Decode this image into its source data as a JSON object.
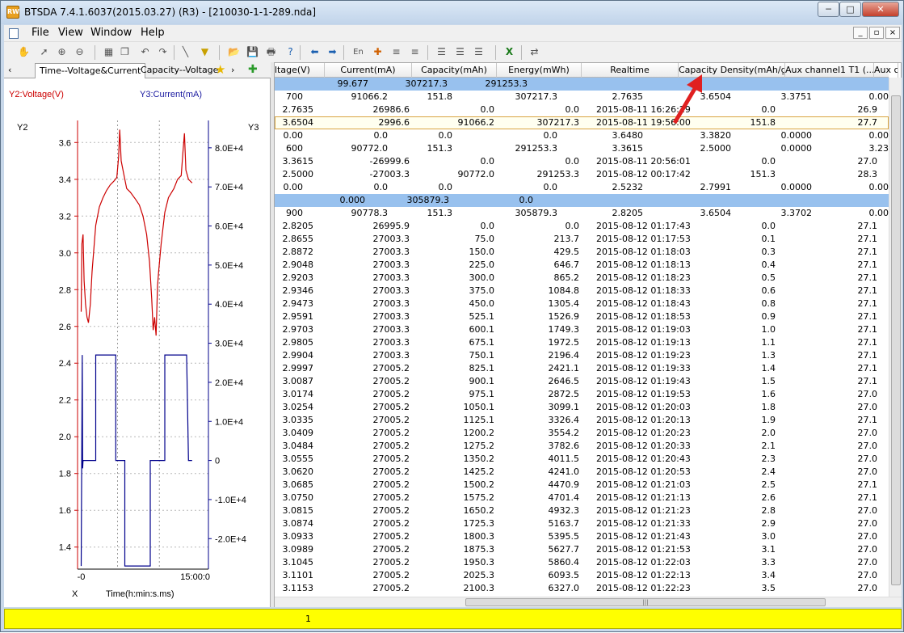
{
  "app": {
    "title": "BTSDA 7.4.1.6037(2015.03.27) (R3) - [210030-1-1-289.nda]",
    "icon_text": "RW"
  },
  "window_controls": {
    "minimize": "─",
    "maximize": "□",
    "close": "✕"
  },
  "menu": {
    "items": [
      "File",
      "View",
      "Window",
      "Help"
    ],
    "mdi": [
      "_",
      "▫",
      "×"
    ]
  },
  "toolbar": {
    "icons": [
      "hand-icon",
      "pointer-icon",
      "zoom-in-icon",
      "zoom-out-icon",
      "table-icon",
      "copy-icon",
      "undo-icon",
      "redo-icon",
      "line-tool-icon",
      "filter-icon",
      "open-icon",
      "save-icon",
      "print-icon",
      "help-icon",
      "back-icon",
      "forward-icon",
      "lang-icon",
      "marker-icon",
      "align-icon",
      "align2-icon",
      "list-icon",
      "list2-icon",
      "list3-icon",
      "excel-icon",
      "convert-icon"
    ],
    "lang_label": "En"
  },
  "tabs": {
    "items": [
      "Time--Voltage&Current",
      "Capacity--Voltage"
    ],
    "left_arrow": "‹",
    "right_arrow": "›"
  },
  "chart_data": {
    "type": "line",
    "xlabel": "Time(h:min:s.ms)",
    "x_axis_letter": "X",
    "x_tick_labels": [
      "-0",
      "15:00:0"
    ],
    "y2_title": "Y2:Voltage(V)",
    "y3_title": "Y3:Current(mA)",
    "y2_axis_letter": "Y2",
    "y3_axis_letter": "Y3",
    "y2_ticks": [
      1.4,
      1.6,
      1.8,
      2.0,
      2.2,
      2.4,
      2.6,
      2.8,
      3.0,
      3.2,
      3.4,
      3.6
    ],
    "y2_tick_labels": [
      "1.4",
      "1.6",
      "1.8",
      "2.0",
      "2.2",
      "2.4",
      "2.6",
      "2.8",
      "3.0",
      "3.2",
      "3.4",
      "3.6"
    ],
    "y2_range": [
      1.28,
      3.72
    ],
    "y3_ticks": [
      -20000,
      -10000,
      0,
      10000,
      20000,
      30000,
      40000,
      50000,
      60000,
      70000,
      80000
    ],
    "y3_tick_labels": [
      "-2.0E+4",
      "-1.0E+4",
      "0",
      "1.0E+4",
      "2.0E+4",
      "3.0E+4",
      "4.0E+4",
      "5.0E+4",
      "6.0E+4",
      "7.0E+4",
      "8.0E+4"
    ],
    "y3_range": [
      -27800,
      87000
    ],
    "x_range": [
      -1,
      35
    ],
    "x_grid": [
      10,
      21.5
    ],
    "series": [
      {
        "color": "#cc0000",
        "points": [
          [
            0,
            2.68
          ],
          [
            0.2,
            3.05
          ],
          [
            0.5,
            3.1
          ],
          [
            0.8,
            2.85
          ],
          [
            1.2,
            2.72
          ],
          [
            1.6,
            2.65
          ],
          [
            2,
            2.62
          ],
          [
            2.5,
            2.72
          ],
          [
            3,
            2.9
          ],
          [
            4,
            3.15
          ],
          [
            5,
            3.25
          ],
          [
            6,
            3.3
          ],
          [
            7,
            3.34
          ],
          [
            8,
            3.37
          ],
          [
            9,
            3.39
          ],
          [
            9.8,
            3.41
          ],
          [
            10.3,
            3.52
          ],
          [
            10.6,
            3.67
          ],
          [
            11,
            3.5
          ],
          [
            11.8,
            3.42
          ],
          [
            12.5,
            3.35
          ],
          [
            13.5,
            3.33
          ],
          [
            15,
            3.29
          ],
          [
            16,
            3.26
          ],
          [
            17,
            3.2
          ],
          [
            18,
            3.1
          ],
          [
            18.8,
            2.95
          ],
          [
            19.4,
            2.75
          ],
          [
            19.8,
            2.58
          ],
          [
            20.2,
            2.65
          ],
          [
            20.6,
            2.55
          ],
          [
            21,
            2.82
          ],
          [
            21.3,
            2.9
          ],
          [
            22,
            3.05
          ],
          [
            23,
            3.22
          ],
          [
            24,
            3.3
          ],
          [
            25.5,
            3.35
          ],
          [
            26.5,
            3.4
          ],
          [
            27.5,
            3.42
          ],
          [
            28,
            3.55
          ],
          [
            28.4,
            3.65
          ],
          [
            28.8,
            3.45
          ],
          [
            29.5,
            3.4
          ],
          [
            30.5,
            3.38
          ]
        ]
      },
      {
        "color": "#00008b",
        "axis": "y3",
        "points": [
          [
            0,
            -27000
          ],
          [
            0.3,
            27000
          ],
          [
            0.4,
            -2000
          ],
          [
            0.5,
            0
          ],
          [
            4,
            0
          ],
          [
            4,
            27000
          ],
          [
            9.5,
            27000
          ],
          [
            9.5,
            0
          ],
          [
            12,
            0
          ],
          [
            12,
            -27000
          ],
          [
            19,
            -27000
          ],
          [
            19,
            0
          ],
          [
            23,
            0
          ],
          [
            23,
            27000
          ],
          [
            29,
            27000
          ],
          [
            29.3,
            12000
          ],
          [
            29.5,
            0
          ],
          [
            30.5,
            0
          ]
        ]
      }
    ]
  },
  "table": {
    "columns": [
      "ltage(V)",
      "Current(mA)",
      "Capacity(mAh)",
      "Energy(mWh)",
      "Realtime",
      "Capacity Density(mAh/g)",
      "Aux channel1 T1 (...",
      "Aux c"
    ],
    "rows": [
      {
        "style": "blue",
        "cells": [
          "",
          "99.677",
          "307217.3",
          "291253.3",
          "",
          "",
          "",
          ""
        ],
        "shift": "summary"
      },
      {
        "style": "",
        "cells": [
          "700",
          "91066.2",
          "151.8",
          "307217.3",
          "2.7635",
          "3.6504",
          "3.3751",
          "0.00"
        ],
        "shift": "cycle"
      },
      {
        "style": "",
        "cells": [
          "2.7635",
          "26986.6",
          "0.0",
          "0.0",
          "2015-08-11 16:26:29",
          "",
          "0.0",
          "26.9"
        ],
        "shift": "step"
      },
      {
        "style": "sel",
        "cells": [
          "3.6504",
          "2996.6",
          "91066.2",
          "307217.3",
          "2015-08-11 19:56:00",
          "",
          "151.8",
          "27.7"
        ],
        "shift": "step"
      },
      {
        "style": "",
        "cells": [
          "0.00",
          "0.0",
          "0.0",
          "0.0",
          "3.6480",
          "3.3820",
          "0.0000",
          "0.00"
        ],
        "shift": "cycle"
      },
      {
        "style": "",
        "cells": [
          "600",
          "90772.0",
          "151.3",
          "291253.3",
          "3.3615",
          "2.5000",
          "0.0000",
          "3.23"
        ],
        "shift": "cycle"
      },
      {
        "style": "",
        "cells": [
          "3.3615",
          "-26999.6",
          "0.0",
          "0.0",
          "2015-08-11 20:56:01",
          "",
          "0.0",
          "27.0"
        ],
        "shift": "step"
      },
      {
        "style": "",
        "cells": [
          "2.5000",
          "-27003.3",
          "90772.0",
          "291253.3",
          "2015-08-12 00:17:42",
          "",
          "151.3",
          "28.3"
        ],
        "shift": "step"
      },
      {
        "style": "",
        "cells": [
          "0.00",
          "0.0",
          "0.0",
          "0.0",
          "2.5232",
          "2.7991",
          "0.0000",
          "0.00"
        ],
        "shift": "cycle"
      },
      {
        "style": "blue",
        "cells": [
          "",
          "0.000",
          "305879.3",
          "0.0",
          "",
          "",
          "",
          ""
        ],
        "shift": "summary2"
      },
      {
        "style": "",
        "cells": [
          "900",
          "90778.3",
          "151.3",
          "305879.3",
          "2.8205",
          "3.6504",
          "3.3702",
          "0.00"
        ],
        "shift": "cycle"
      },
      {
        "style": "",
        "cells": [
          "2.8205",
          "26995.9",
          "0.0",
          "0.0",
          "2015-08-12 01:17:43",
          "",
          "0.0",
          "27.1"
        ],
        "shift": "step"
      },
      {
        "style": "",
        "cells": [
          "2.8655",
          "27003.3",
          "75.0",
          "213.7",
          "2015-08-12 01:17:53",
          "",
          "0.1",
          "27.1"
        ],
        "shift": "step"
      },
      {
        "style": "",
        "cells": [
          "2.8872",
          "27003.3",
          "150.0",
          "429.5",
          "2015-08-12 01:18:03",
          "",
          "0.3",
          "27.1"
        ],
        "shift": "step"
      },
      {
        "style": "",
        "cells": [
          "2.9048",
          "27003.3",
          "225.0",
          "646.7",
          "2015-08-12 01:18:13",
          "",
          "0.4",
          "27.1"
        ],
        "shift": "step"
      },
      {
        "style": "",
        "cells": [
          "2.9203",
          "27003.3",
          "300.0",
          "865.2",
          "2015-08-12 01:18:23",
          "",
          "0.5",
          "27.1"
        ],
        "shift": "step"
      },
      {
        "style": "",
        "cells": [
          "2.9346",
          "27003.3",
          "375.0",
          "1084.8",
          "2015-08-12 01:18:33",
          "",
          "0.6",
          "27.1"
        ],
        "shift": "step"
      },
      {
        "style": "",
        "cells": [
          "2.9473",
          "27003.3",
          "450.0",
          "1305.4",
          "2015-08-12 01:18:43",
          "",
          "0.8",
          "27.1"
        ],
        "shift": "step"
      },
      {
        "style": "",
        "cells": [
          "2.9591",
          "27003.3",
          "525.1",
          "1526.9",
          "2015-08-12 01:18:53",
          "",
          "0.9",
          "27.1"
        ],
        "shift": "step"
      },
      {
        "style": "",
        "cells": [
          "2.9703",
          "27003.3",
          "600.1",
          "1749.3",
          "2015-08-12 01:19:03",
          "",
          "1.0",
          "27.1"
        ],
        "shift": "step"
      },
      {
        "style": "",
        "cells": [
          "2.9805",
          "27003.3",
          "675.1",
          "1972.5",
          "2015-08-12 01:19:13",
          "",
          "1.1",
          "27.1"
        ],
        "shift": "step"
      },
      {
        "style": "",
        "cells": [
          "2.9904",
          "27003.3",
          "750.1",
          "2196.4",
          "2015-08-12 01:19:23",
          "",
          "1.3",
          "27.1"
        ],
        "shift": "step"
      },
      {
        "style": "",
        "cells": [
          "2.9997",
          "27005.2",
          "825.1",
          "2421.1",
          "2015-08-12 01:19:33",
          "",
          "1.4",
          "27.1"
        ],
        "shift": "step"
      },
      {
        "style": "",
        "cells": [
          "3.0087",
          "27005.2",
          "900.1",
          "2646.5",
          "2015-08-12 01:19:43",
          "",
          "1.5",
          "27.1"
        ],
        "shift": "step"
      },
      {
        "style": "",
        "cells": [
          "3.0174",
          "27005.2",
          "975.1",
          "2872.5",
          "2015-08-12 01:19:53",
          "",
          "1.6",
          "27.0"
        ],
        "shift": "step"
      },
      {
        "style": "",
        "cells": [
          "3.0254",
          "27005.2",
          "1050.1",
          "3099.1",
          "2015-08-12 01:20:03",
          "",
          "1.8",
          "27.0"
        ],
        "shift": "step"
      },
      {
        "style": "",
        "cells": [
          "3.0335",
          "27005.2",
          "1125.1",
          "3326.4",
          "2015-08-12 01:20:13",
          "",
          "1.9",
          "27.1"
        ],
        "shift": "step"
      },
      {
        "style": "",
        "cells": [
          "3.0409",
          "27005.2",
          "1200.2",
          "3554.2",
          "2015-08-12 01:20:23",
          "",
          "2.0",
          "27.0"
        ],
        "shift": "step"
      },
      {
        "style": "",
        "cells": [
          "3.0484",
          "27005.2",
          "1275.2",
          "3782.6",
          "2015-08-12 01:20:33",
          "",
          "2.1",
          "27.0"
        ],
        "shift": "step"
      },
      {
        "style": "",
        "cells": [
          "3.0555",
          "27005.2",
          "1350.2",
          "4011.5",
          "2015-08-12 01:20:43",
          "",
          "2.3",
          "27.0"
        ],
        "shift": "step"
      },
      {
        "style": "",
        "cells": [
          "3.0620",
          "27005.2",
          "1425.2",
          "4241.0",
          "2015-08-12 01:20:53",
          "",
          "2.4",
          "27.0"
        ],
        "shift": "step"
      },
      {
        "style": "",
        "cells": [
          "3.0685",
          "27005.2",
          "1500.2",
          "4470.9",
          "2015-08-12 01:21:03",
          "",
          "2.5",
          "27.1"
        ],
        "shift": "step"
      },
      {
        "style": "",
        "cells": [
          "3.0750",
          "27005.2",
          "1575.2",
          "4701.4",
          "2015-08-12 01:21:13",
          "",
          "2.6",
          "27.1"
        ],
        "shift": "step"
      },
      {
        "style": "",
        "cells": [
          "3.0815",
          "27005.2",
          "1650.2",
          "4932.3",
          "2015-08-12 01:21:23",
          "",
          "2.8",
          "27.0"
        ],
        "shift": "step"
      },
      {
        "style": "",
        "cells": [
          "3.0874",
          "27005.2",
          "1725.3",
          "5163.7",
          "2015-08-12 01:21:33",
          "",
          "2.9",
          "27.0"
        ],
        "shift": "step"
      },
      {
        "style": "",
        "cells": [
          "3.0933",
          "27005.2",
          "1800.3",
          "5395.5",
          "2015-08-12 01:21:43",
          "",
          "3.0",
          "27.0"
        ],
        "shift": "step"
      },
      {
        "style": "",
        "cells": [
          "3.0989",
          "27005.2",
          "1875.3",
          "5627.7",
          "2015-08-12 01:21:53",
          "",
          "3.1",
          "27.0"
        ],
        "shift": "step"
      },
      {
        "style": "",
        "cells": [
          "3.1045",
          "27005.2",
          "1950.3",
          "5860.4",
          "2015-08-12 01:22:03",
          "",
          "3.3",
          "27.0"
        ],
        "shift": "step"
      },
      {
        "style": "",
        "cells": [
          "3.1101",
          "27005.2",
          "2025.3",
          "6093.5",
          "2015-08-12 01:22:13",
          "",
          "3.4",
          "27.0"
        ],
        "shift": "step"
      },
      {
        "style": "",
        "cells": [
          "3.1153",
          "27005.2",
          "2100.3",
          "6327.0",
          "2015-08-12 01:22:23",
          "",
          "3.5",
          "27.0"
        ],
        "shift": "step"
      }
    ]
  },
  "scroll": {
    "hgrip": "|||"
  },
  "statusbar": {
    "text": "1"
  },
  "colors": {
    "voltage": "#cc0000",
    "current": "#00008b",
    "summary_row": "#98c1ee",
    "status": "#ffff00",
    "arrow": "#e02020"
  }
}
